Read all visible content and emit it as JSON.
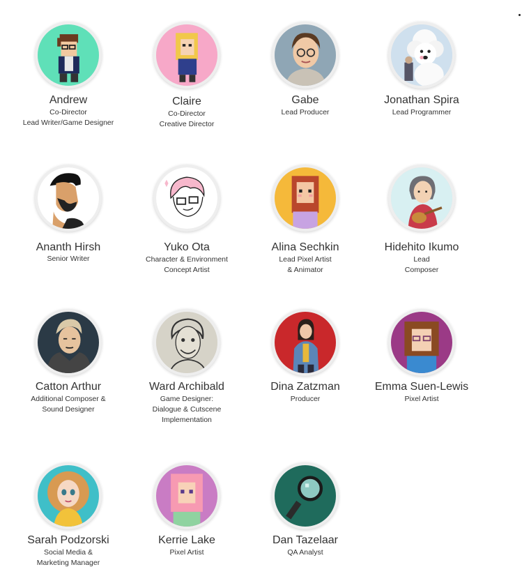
{
  "members": [
    {
      "name": "Andrew",
      "role": "Co-Director\nLead Writer/Game Designer",
      "avatar_icon": "pixel-glasses-man-avatar",
      "bg": "#5fe0b8"
    },
    {
      "name": "Claire",
      "role": "Co-Director\nCreative Director",
      "avatar_icon": "pixel-blonde-woman-avatar",
      "bg": "#f7a8c8"
    },
    {
      "name": "Gabe",
      "role": "Lead Producer",
      "avatar_icon": "glasses-man-portrait-avatar",
      "bg": "#8fa6b5"
    },
    {
      "name": "Jonathan Spira",
      "role": "Lead Programmer",
      "avatar_icon": "poodle-avatar",
      "bg": "#cfe0ee"
    },
    {
      "name": "Ananth Hirsh",
      "role": "Senior Writer",
      "avatar_icon": "bearded-man-profile-avatar",
      "bg": "#ffffff"
    },
    {
      "name": "Yuko Ota",
      "role": "Character & Environment\nConcept Artist",
      "avatar_icon": "sketch-pink-hair-avatar",
      "bg": "#ffffff"
    },
    {
      "name": "Alina Sechkin",
      "role": "Lead Pixel Artist\n& Animator",
      "avatar_icon": "pixel-redhead-avatar",
      "bg": "#f5b93a"
    },
    {
      "name": "Hidehito Ikumo",
      "role": "Lead\nComposer",
      "avatar_icon": "guitar-player-avatar",
      "bg": "#d8f0f2"
    },
    {
      "name": "Catton Arthur",
      "role": "Additional Composer &\nSound Designer",
      "avatar_icon": "hooded-man-avatar",
      "bg": "#2b3a46"
    },
    {
      "name": "Ward Archibald",
      "role": "Game Designer:\nDialogue & Cutscene\nImplementation",
      "avatar_icon": "pencil-sketch-man-avatar",
      "bg": "#d6d3c8"
    },
    {
      "name": "Dina Zatzman",
      "role": "Producer",
      "avatar_icon": "woman-denim-jacket-avatar",
      "bg": "#c9282b"
    },
    {
      "name": "Emma Suen-Lewis",
      "role": "Pixel Artist",
      "avatar_icon": "pixel-curly-hair-avatar",
      "bg": "#9b3a86"
    },
    {
      "name": "Sarah Podzorski",
      "role": "Social Media &\nMarketing Manager",
      "avatar_icon": "curly-blonde-woman-avatar",
      "bg": "#3fbfc8"
    },
    {
      "name": "Kerrie Lake",
      "role": "Pixel Artist",
      "avatar_icon": "pixel-pink-hair-avatar",
      "bg": "#c97cc4"
    },
    {
      "name": "Dan Tazelaar",
      "role": "QA Analyst",
      "avatar_icon": "magnifying-glass-avatar",
      "bg": "#1f6b5c"
    }
  ]
}
